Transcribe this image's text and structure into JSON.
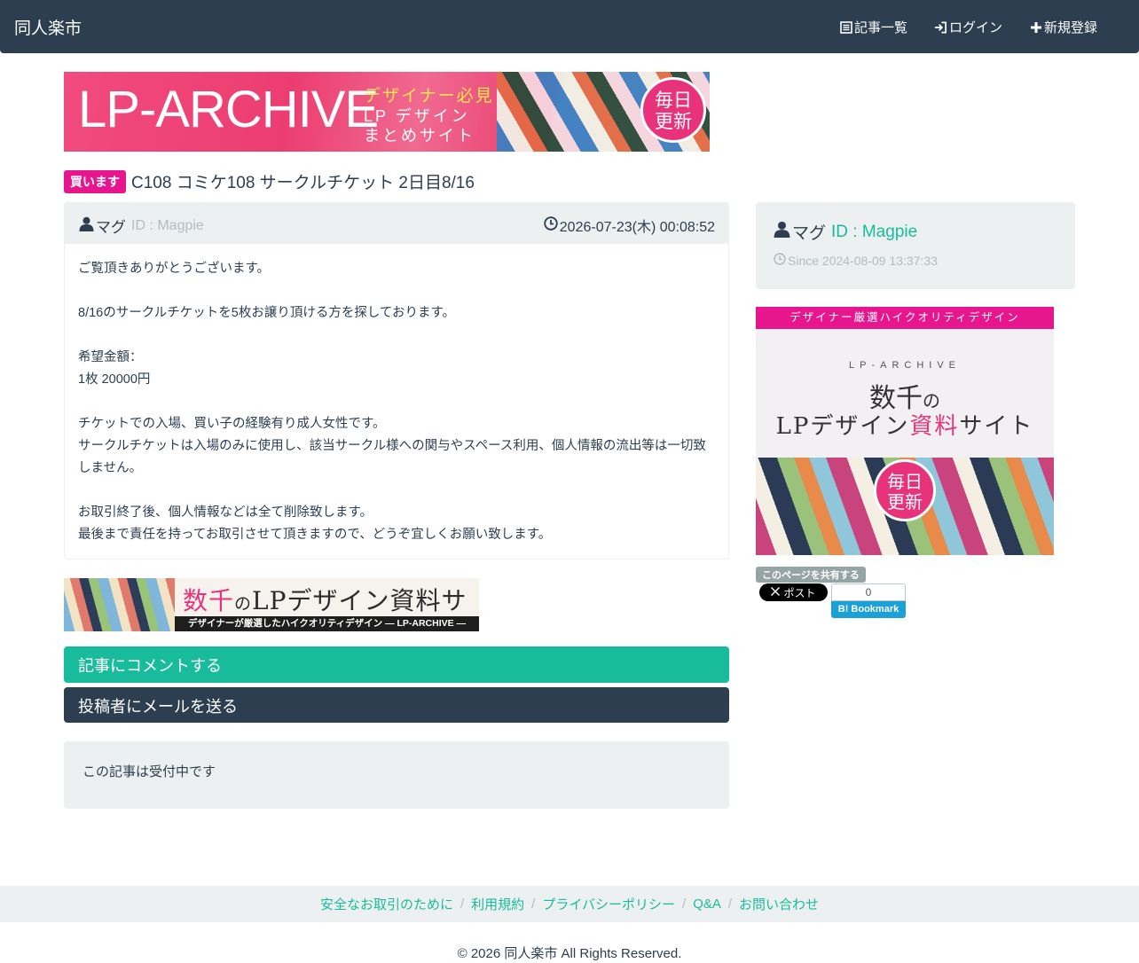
{
  "navbar": {
    "brand": "同人楽市",
    "items": [
      {
        "label": "記事一覧",
        "icon": "list-icon"
      },
      {
        "label": "ログイン",
        "icon": "login-icon"
      },
      {
        "label": "新規登録",
        "icon": "plus-icon"
      }
    ]
  },
  "banner_top": {
    "logo": "LP-ARCHIVE",
    "line1": "デザイナー必見",
    "line2": "LP デザイン",
    "line3": "まとめサイト",
    "badge_line1": "毎日",
    "badge_line2": "更新"
  },
  "post": {
    "label": "買います",
    "title": "C108 コミケ108 サークルチケット 2日目8/16",
    "author": "マグ",
    "author_id": "ID : Magpie",
    "date": "2026-07-23(木) 00:08:52",
    "body": [
      "ご覧頂きありがとうございます。",
      "",
      "8/16のサークルチケットを5枚お譲り頂ける方を探しております。",
      "",
      "希望金額：",
      "1枚 20000円",
      "",
      "チケットでの入場、買い子の経験有り成人女性です。",
      "サークルチケットは入場のみに使用し、該当サークル様への関与やスペース利用、個人情報の流出等は一切致しません。",
      "",
      "お取引終了後、個人情報などは全て削除致します。",
      "最後まで責任を持ってお取引させて頂きますので、どうぞ宜しくお願い致します。"
    ]
  },
  "banner_mid": {
    "headline_a": "数千",
    "headline_b": "の",
    "headline_c": "LPデザイン資料サイト",
    "strip": "デザイナーが厳選したハイクオリティデザイン ― LP-ARCHIVE ―"
  },
  "actions": {
    "comment": "記事にコメントする",
    "mail": "投稿者にメールを送る"
  },
  "status": "この記事は受付中です",
  "sidebar": {
    "name": "マグ",
    "id": "ID : Magpie",
    "since": "Since 2024-08-09 13:37:33",
    "ad": {
      "top": "デザイナー厳選ハイクオリティデザイン",
      "brand": "LP-ARCHIVE",
      "big1a": "数千",
      "big1b": "の",
      "big2a": "LPデザイン",
      "big2b": "資料",
      "big2c": "サイト",
      "badge_line1": "毎日",
      "badge_line2": "更新"
    },
    "share_label": "このページを共有する",
    "x_post": "ポスト",
    "hatena_count": "0",
    "hatena_label": "B! Bookmark"
  },
  "footer": {
    "links": [
      "安全なお取引のために",
      "利用規約",
      "プライバシーポリシー",
      "Q&A",
      "お問い合わせ"
    ],
    "separator": "/",
    "copyright": "© 2026 同人楽市 All Rights Reserved."
  },
  "colors": {
    "navbar": "#2c3e50",
    "accent": "#18bc9c",
    "label_buy": "#e8168e",
    "well": "#ecf0f1"
  }
}
